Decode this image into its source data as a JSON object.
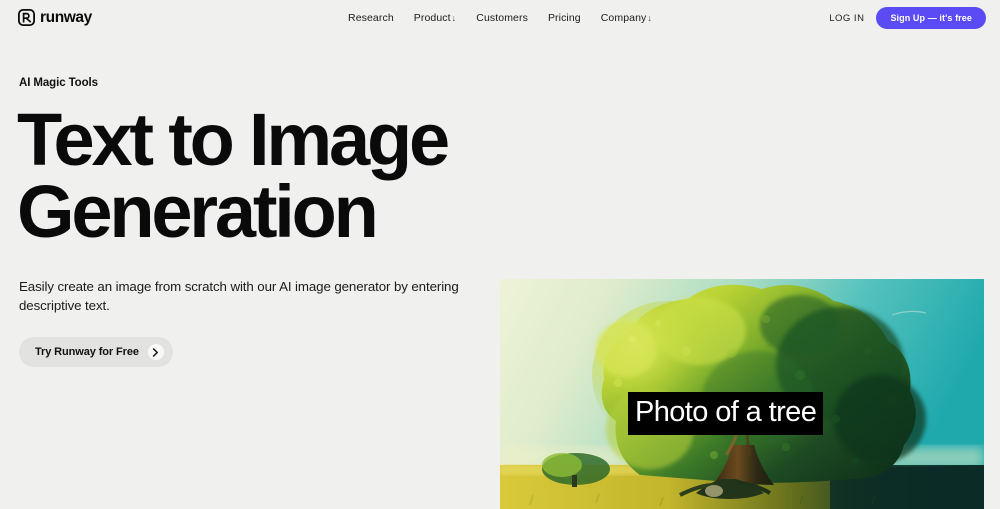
{
  "brand": {
    "name": "runway",
    "logo_icon": "runway-logo-mark"
  },
  "nav": {
    "links": [
      {
        "label": "Research",
        "caret": ""
      },
      {
        "label": "Product",
        "caret": "↓"
      },
      {
        "label": "Customers",
        "caret": ""
      },
      {
        "label": "Pricing",
        "caret": ""
      },
      {
        "label": "Company",
        "caret": "↓"
      }
    ],
    "login_label": "LOG IN",
    "signup_label": "Sign Up — it's free"
  },
  "hero": {
    "eyebrow": "AI Magic Tools",
    "title": "Text to Image Generation",
    "subtitle": "Easily create an image from scratch with our AI image generator by entering descriptive text.",
    "cta_label": "Try Runway for Free",
    "cta_icon": "chevron-right-icon"
  },
  "media": {
    "caption": "Photo of a tree",
    "alt_name": "generated-tree-image"
  },
  "colors": {
    "page_background": "#f0f0ef",
    "accent": "#5b4bf5",
    "text": "#0a0a0a",
    "cta_background": "#e2e2e0",
    "caption_background": "#000000",
    "sky_left": "#e7efc9",
    "sky_right": "#27b0ae",
    "foliage_light": "#c3d33a",
    "foliage_dark": "#16391f",
    "field": "#c9b82e"
  }
}
